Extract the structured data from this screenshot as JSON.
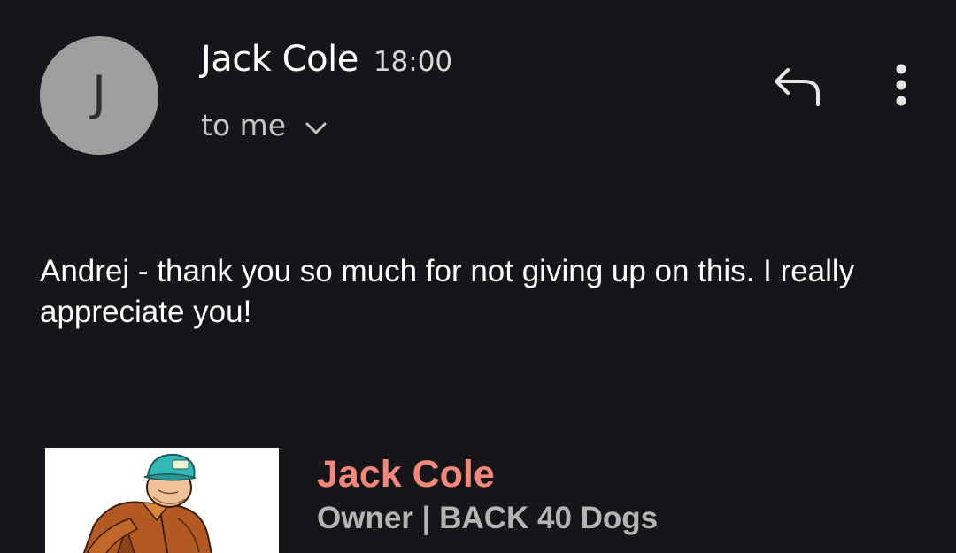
{
  "header": {
    "avatar_letter": "J",
    "sender_name": "Jack Cole",
    "time": "18:00",
    "recipient_label": "to me",
    "icons": {
      "expand": "chevron-down-icon",
      "reply": "reply-icon",
      "more": "more-vert-icon"
    }
  },
  "body": {
    "text": "Andrej - thank you so much for not giving up on this. I really appreciate you!"
  },
  "signature": {
    "name": "Jack Cole",
    "title": "Owner | BACK 40 Dogs",
    "name_color": "#f2877a",
    "title_color": "#b4b4b4",
    "image_icon": "cartoon-man-with-cap"
  },
  "colors": {
    "background": "#16161a",
    "avatar": "#9e9e9e"
  }
}
